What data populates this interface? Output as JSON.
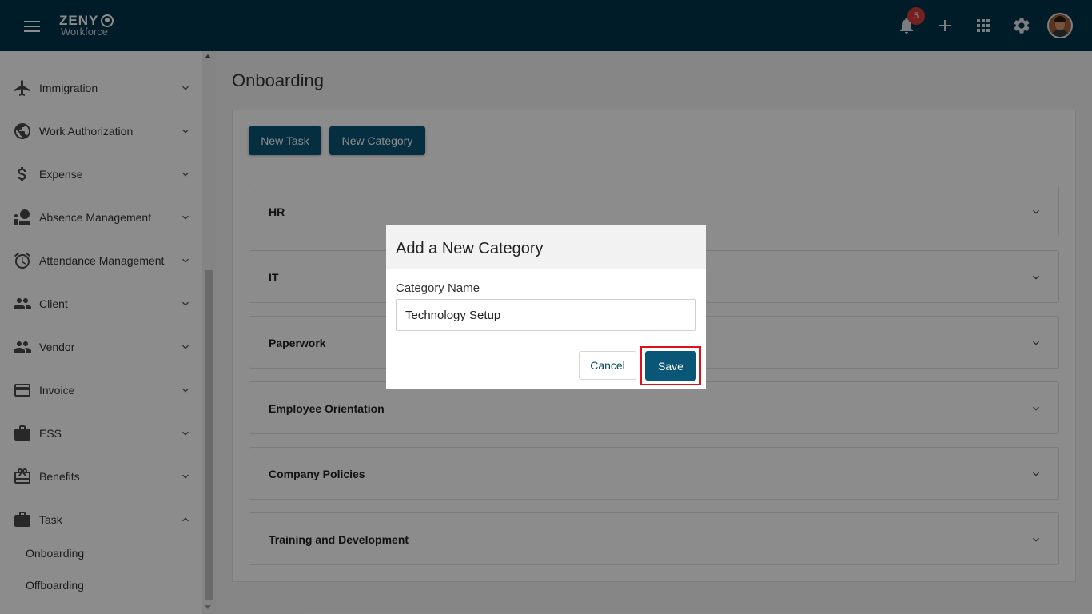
{
  "header": {
    "logo_top": "ZENY",
    "logo_bottom": "Workforce",
    "notification_count": "5"
  },
  "sidebar": {
    "items": [
      {
        "label": "Immigration",
        "icon": "airplane-icon",
        "expanded": false
      },
      {
        "label": "Work Authorization",
        "icon": "globe-icon",
        "expanded": false
      },
      {
        "label": "Expense",
        "icon": "dollar-icon",
        "expanded": false
      },
      {
        "label": "Absence Management",
        "icon": "absence-icon",
        "expanded": false
      },
      {
        "label": "Attendance Management",
        "icon": "alarm-clock-icon",
        "expanded": false
      },
      {
        "label": "Client",
        "icon": "people-icon",
        "expanded": false
      },
      {
        "label": "Vendor",
        "icon": "people-icon",
        "expanded": false
      },
      {
        "label": "Invoice",
        "icon": "credit-card-icon",
        "expanded": false
      },
      {
        "label": "ESS",
        "icon": "briefcase-icon",
        "expanded": false
      },
      {
        "label": "Benefits",
        "icon": "gift-card-icon",
        "expanded": false
      },
      {
        "label": "Task",
        "icon": "briefcase-icon",
        "expanded": true
      }
    ],
    "task_subitems": [
      "Onboarding",
      "Offboarding"
    ]
  },
  "main": {
    "title": "Onboarding",
    "new_task_label": "New Task",
    "new_category_label": "New Category",
    "categories": [
      "HR",
      "IT",
      "Paperwork",
      "Employee Orientation",
      "Company Policies",
      "Training and Development"
    ]
  },
  "dialog": {
    "title": "Add a New Category",
    "field_label": "Category Name",
    "field_value": "Technology Setup",
    "cancel_label": "Cancel",
    "save_label": "Save"
  },
  "colors": {
    "topbar": "#00344a",
    "primary_button": "#0a5677",
    "badge": "#d63b3b",
    "highlight": "#e0101a"
  }
}
